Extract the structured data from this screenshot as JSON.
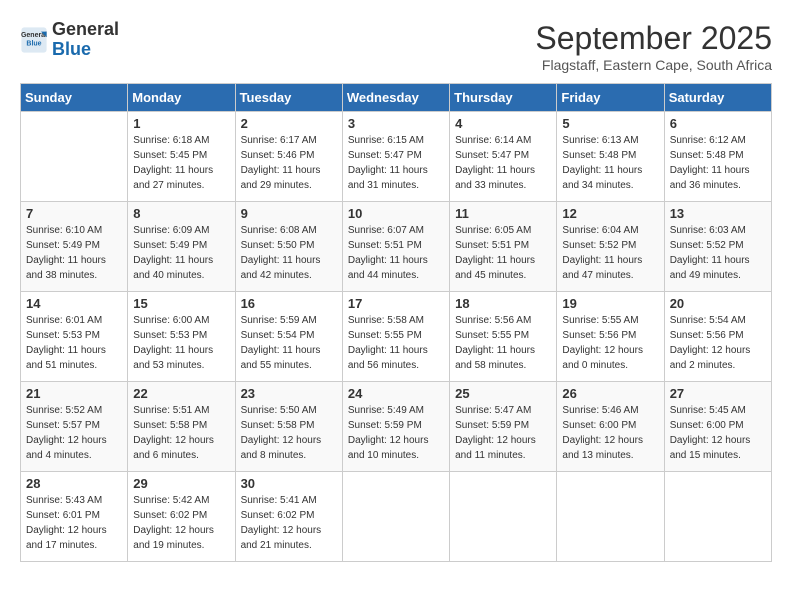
{
  "logo": {
    "line1": "General",
    "line2": "Blue"
  },
  "title": "September 2025",
  "subtitle": "Flagstaff, Eastern Cape, South Africa",
  "days_header": [
    "Sunday",
    "Monday",
    "Tuesday",
    "Wednesday",
    "Thursday",
    "Friday",
    "Saturday"
  ],
  "weeks": [
    [
      {
        "day": "",
        "data": ""
      },
      {
        "day": "1",
        "data": "Sunrise: 6:18 AM\nSunset: 5:45 PM\nDaylight: 11 hours\nand 27 minutes."
      },
      {
        "day": "2",
        "data": "Sunrise: 6:17 AM\nSunset: 5:46 PM\nDaylight: 11 hours\nand 29 minutes."
      },
      {
        "day": "3",
        "data": "Sunrise: 6:15 AM\nSunset: 5:47 PM\nDaylight: 11 hours\nand 31 minutes."
      },
      {
        "day": "4",
        "data": "Sunrise: 6:14 AM\nSunset: 5:47 PM\nDaylight: 11 hours\nand 33 minutes."
      },
      {
        "day": "5",
        "data": "Sunrise: 6:13 AM\nSunset: 5:48 PM\nDaylight: 11 hours\nand 34 minutes."
      },
      {
        "day": "6",
        "data": "Sunrise: 6:12 AM\nSunset: 5:48 PM\nDaylight: 11 hours\nand 36 minutes."
      }
    ],
    [
      {
        "day": "7",
        "data": "Sunrise: 6:10 AM\nSunset: 5:49 PM\nDaylight: 11 hours\nand 38 minutes."
      },
      {
        "day": "8",
        "data": "Sunrise: 6:09 AM\nSunset: 5:49 PM\nDaylight: 11 hours\nand 40 minutes."
      },
      {
        "day": "9",
        "data": "Sunrise: 6:08 AM\nSunset: 5:50 PM\nDaylight: 11 hours\nand 42 minutes."
      },
      {
        "day": "10",
        "data": "Sunrise: 6:07 AM\nSunset: 5:51 PM\nDaylight: 11 hours\nand 44 minutes."
      },
      {
        "day": "11",
        "data": "Sunrise: 6:05 AM\nSunset: 5:51 PM\nDaylight: 11 hours\nand 45 minutes."
      },
      {
        "day": "12",
        "data": "Sunrise: 6:04 AM\nSunset: 5:52 PM\nDaylight: 11 hours\nand 47 minutes."
      },
      {
        "day": "13",
        "data": "Sunrise: 6:03 AM\nSunset: 5:52 PM\nDaylight: 11 hours\nand 49 minutes."
      }
    ],
    [
      {
        "day": "14",
        "data": "Sunrise: 6:01 AM\nSunset: 5:53 PM\nDaylight: 11 hours\nand 51 minutes."
      },
      {
        "day": "15",
        "data": "Sunrise: 6:00 AM\nSunset: 5:53 PM\nDaylight: 11 hours\nand 53 minutes."
      },
      {
        "day": "16",
        "data": "Sunrise: 5:59 AM\nSunset: 5:54 PM\nDaylight: 11 hours\nand 55 minutes."
      },
      {
        "day": "17",
        "data": "Sunrise: 5:58 AM\nSunset: 5:55 PM\nDaylight: 11 hours\nand 56 minutes."
      },
      {
        "day": "18",
        "data": "Sunrise: 5:56 AM\nSunset: 5:55 PM\nDaylight: 11 hours\nand 58 minutes."
      },
      {
        "day": "19",
        "data": "Sunrise: 5:55 AM\nSunset: 5:56 PM\nDaylight: 12 hours\nand 0 minutes."
      },
      {
        "day": "20",
        "data": "Sunrise: 5:54 AM\nSunset: 5:56 PM\nDaylight: 12 hours\nand 2 minutes."
      }
    ],
    [
      {
        "day": "21",
        "data": "Sunrise: 5:52 AM\nSunset: 5:57 PM\nDaylight: 12 hours\nand 4 minutes."
      },
      {
        "day": "22",
        "data": "Sunrise: 5:51 AM\nSunset: 5:58 PM\nDaylight: 12 hours\nand 6 minutes."
      },
      {
        "day": "23",
        "data": "Sunrise: 5:50 AM\nSunset: 5:58 PM\nDaylight: 12 hours\nand 8 minutes."
      },
      {
        "day": "24",
        "data": "Sunrise: 5:49 AM\nSunset: 5:59 PM\nDaylight: 12 hours\nand 10 minutes."
      },
      {
        "day": "25",
        "data": "Sunrise: 5:47 AM\nSunset: 5:59 PM\nDaylight: 12 hours\nand 11 minutes."
      },
      {
        "day": "26",
        "data": "Sunrise: 5:46 AM\nSunset: 6:00 PM\nDaylight: 12 hours\nand 13 minutes."
      },
      {
        "day": "27",
        "data": "Sunrise: 5:45 AM\nSunset: 6:00 PM\nDaylight: 12 hours\nand 15 minutes."
      }
    ],
    [
      {
        "day": "28",
        "data": "Sunrise: 5:43 AM\nSunset: 6:01 PM\nDaylight: 12 hours\nand 17 minutes."
      },
      {
        "day": "29",
        "data": "Sunrise: 5:42 AM\nSunset: 6:02 PM\nDaylight: 12 hours\nand 19 minutes."
      },
      {
        "day": "30",
        "data": "Sunrise: 5:41 AM\nSunset: 6:02 PM\nDaylight: 12 hours\nand 21 minutes."
      },
      {
        "day": "",
        "data": ""
      },
      {
        "day": "",
        "data": ""
      },
      {
        "day": "",
        "data": ""
      },
      {
        "day": "",
        "data": ""
      }
    ]
  ]
}
